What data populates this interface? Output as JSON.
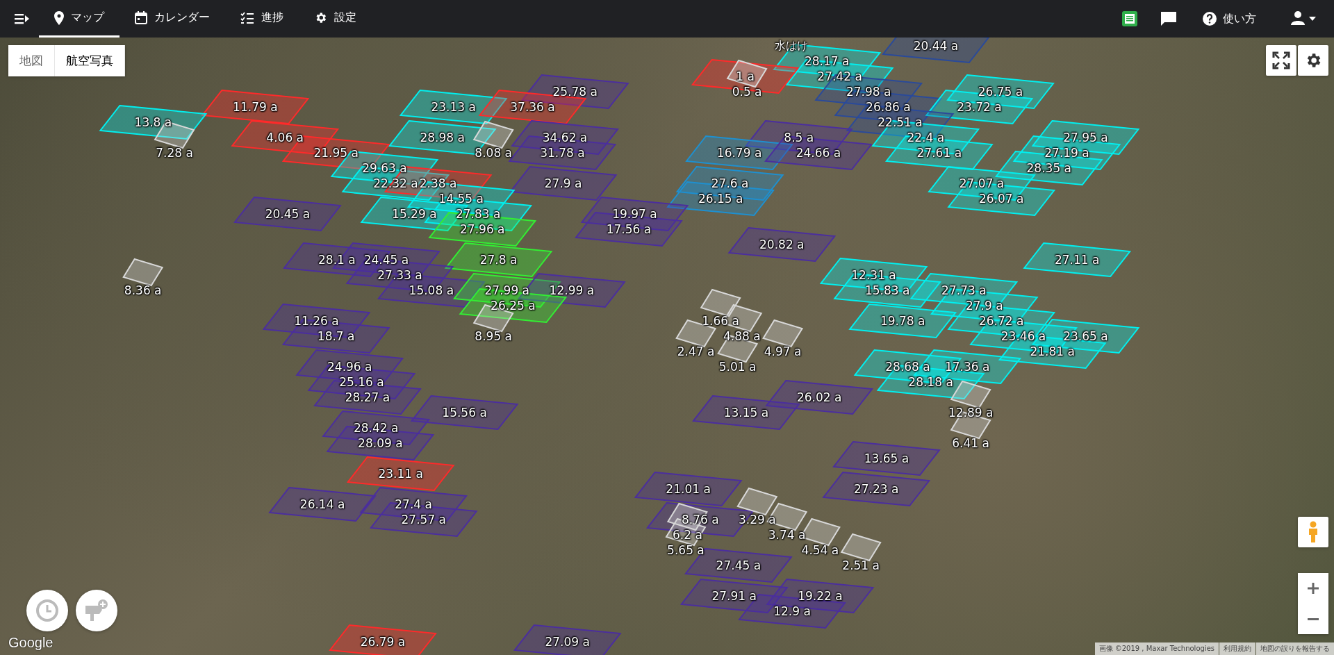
{
  "nav": {
    "tabs": [
      {
        "label": "マップ",
        "selected": true
      },
      {
        "label": "カレンダー",
        "selected": false
      },
      {
        "label": "進捗",
        "selected": false
      },
      {
        "label": "設定",
        "selected": false
      }
    ],
    "help_label": "使い方"
  },
  "map": {
    "type_tabs": [
      {
        "label": "地図",
        "selected": false
      },
      {
        "label": "航空写真",
        "selected": true
      }
    ],
    "notes": [
      "水はけ"
    ],
    "fields": [
      {
        "label": "20.44 a",
        "color": "#2a4a9a"
      },
      {
        "label": "28.17 a",
        "color": "#00f0f0"
      },
      {
        "label": "1 a",
        "color": "#ff2a2a"
      },
      {
        "label": "27.42 a",
        "color": "#00f0f0"
      },
      {
        "label": "25.78 a",
        "color": "#4b2e9e"
      },
      {
        "label": "0.5 a",
        "color": "#d8d8d8"
      },
      {
        "label": "27.98 a",
        "color": "#2a4a9a"
      },
      {
        "label": "26.75 a",
        "color": "#00f0f0"
      },
      {
        "label": "11.79 a",
        "color": "#ff2a2a"
      },
      {
        "label": "23.13 a",
        "color": "#00f0f0"
      },
      {
        "label": "37.36 a",
        "color": "#ff2a2a"
      },
      {
        "label": "26.86 a",
        "color": "#2a4a9a"
      },
      {
        "label": "23.72 a",
        "color": "#00f0f0"
      },
      {
        "label": "13.8 a",
        "color": "#00f0f0"
      },
      {
        "label": "22.51 a",
        "color": "#2a4a9a"
      },
      {
        "label": "4.06 a",
        "color": "#ff2a2a"
      },
      {
        "label": "28.98 a",
        "color": "#00f0f0"
      },
      {
        "label": "34.62 a",
        "color": "#4b2e9e"
      },
      {
        "label": "8.5 a",
        "color": "#4b2e9e"
      },
      {
        "label": "22.4 a",
        "color": "#00f0f0"
      },
      {
        "label": "27.95 a",
        "color": "#00f0f0"
      },
      {
        "label": "7.28 a",
        "color": "#d8d8d8"
      },
      {
        "label": "21.95 a",
        "color": "#ff2a2a"
      },
      {
        "label": "8.08 a",
        "color": "#d8d8d8"
      },
      {
        "label": "31.78 a",
        "color": "#4b2e9e"
      },
      {
        "label": "16.79 a",
        "color": "#1e90d0"
      },
      {
        "label": "24.66 a",
        "color": "#4b2e9e"
      },
      {
        "label": "27.61 a",
        "color": "#00f0f0"
      },
      {
        "label": "27.19 a",
        "color": "#00f0f0"
      },
      {
        "label": "29.63 a",
        "color": "#00f0f0"
      },
      {
        "label": "28.35 a",
        "color": "#00f0f0"
      },
      {
        "label": "22.32 a",
        "color": "#00f0f0"
      },
      {
        "label": "2.38 a",
        "color": "#ff2a2a"
      },
      {
        "label": "27.9 a",
        "color": "#4b2e9e"
      },
      {
        "label": "27.6 a",
        "color": "#1e90d0"
      },
      {
        "label": "27.07 a",
        "color": "#00f0f0"
      },
      {
        "label": "14.55 a",
        "color": "#00f0f0"
      },
      {
        "label": "26.15 a",
        "color": "#1e90d0"
      },
      {
        "label": "26.07 a",
        "color": "#00f0f0"
      },
      {
        "label": "20.45 a",
        "color": "#4b2e9e"
      },
      {
        "label": "15.29 a",
        "color": "#00f0f0"
      },
      {
        "label": "27.83 a",
        "color": "#00f0f0"
      },
      {
        "label": "19.97 a",
        "color": "#4b2e9e"
      },
      {
        "label": "27.96 a",
        "color": "#33ee33"
      },
      {
        "label": "17.56 a",
        "color": "#4b2e9e"
      },
      {
        "label": "20.82 a",
        "color": "#4b2e9e"
      },
      {
        "label": "28.1 a",
        "color": "#4b2e9e"
      },
      {
        "label": "24.45 a",
        "color": "#4b2e9e"
      },
      {
        "label": "27.8 a",
        "color": "#33ee33"
      },
      {
        "label": "27.11 a",
        "color": "#00f0f0"
      },
      {
        "label": "27.33 a",
        "color": "#4b2e9e"
      },
      {
        "label": "12.31 a",
        "color": "#00f0f0"
      },
      {
        "label": "8.36 a",
        "color": "#d8d8d8"
      },
      {
        "label": "15.08 a",
        "color": "#4b2e9e"
      },
      {
        "label": "27.99 a",
        "color": "#33ee33"
      },
      {
        "label": "12.99 a",
        "color": "#4b2e9e"
      },
      {
        "label": "15.83 a",
        "color": "#00f0f0"
      },
      {
        "label": "27.73 a",
        "color": "#00f0f0"
      },
      {
        "label": "26.25 a",
        "color": "#33ee33"
      },
      {
        "label": "27.9 a",
        "color": "#00f0f0"
      },
      {
        "label": "11.26 a",
        "color": "#4b2e9e"
      },
      {
        "label": "1.66 a",
        "color": "#d8d8d8"
      },
      {
        "label": "19.78 a",
        "color": "#00f0f0"
      },
      {
        "label": "26.72 a",
        "color": "#00f0f0"
      },
      {
        "label": "18.7 a",
        "color": "#4b2e9e"
      },
      {
        "label": "8.95 a",
        "color": "#d8d8d8"
      },
      {
        "label": "4.88 a",
        "color": "#d8d8d8"
      },
      {
        "label": "23.46 a",
        "color": "#00f0f0"
      },
      {
        "label": "23.65 a",
        "color": "#00f0f0"
      },
      {
        "label": "2.47 a",
        "color": "#d8d8d8"
      },
      {
        "label": "4.97 a",
        "color": "#d8d8d8"
      },
      {
        "label": "21.81 a",
        "color": "#00f0f0"
      },
      {
        "label": "24.96 a",
        "color": "#4b2e9e"
      },
      {
        "label": "5.01 a",
        "color": "#d8d8d8"
      },
      {
        "label": "28.68 a",
        "color": "#00f0f0"
      },
      {
        "label": "17.36 a",
        "color": "#00f0f0"
      },
      {
        "label": "25.16 a",
        "color": "#4b2e9e"
      },
      {
        "label": "28.18 a",
        "color": "#00f0f0"
      },
      {
        "label": "28.27 a",
        "color": "#4b2e9e"
      },
      {
        "label": "26.02 a",
        "color": "#4b2e9e"
      },
      {
        "label": "15.56 a",
        "color": "#4b2e9e"
      },
      {
        "label": "13.15 a",
        "color": "#4b2e9e"
      },
      {
        "label": "12.89 a",
        "color": "#d8d8d8"
      },
      {
        "label": "28.42 a",
        "color": "#4b2e9e"
      },
      {
        "label": "28.09 a",
        "color": "#4b2e9e"
      },
      {
        "label": "6.41 a",
        "color": "#d8d8d8"
      },
      {
        "label": "13.65 a",
        "color": "#4b2e9e"
      },
      {
        "label": "23.11 a",
        "color": "#ff2a2a"
      },
      {
        "label": "27.23 a",
        "color": "#4b2e9e"
      },
      {
        "label": "27.4 a",
        "color": "#4b2e9e"
      },
      {
        "label": "21.01 a",
        "color": "#4b2e9e"
      },
      {
        "label": "26.14 a",
        "color": "#4b2e9e"
      },
      {
        "label": "27.57 a",
        "color": "#4b2e9e"
      },
      {
        "label": "8.76 a",
        "color": "#4b2e9e"
      },
      {
        "label": "3.29 a",
        "color": "#d8d8d8"
      },
      {
        "label": "6.2 a",
        "color": "#d8d8d8"
      },
      {
        "label": "3.74 a",
        "color": "#d8d8d8"
      },
      {
        "label": "5.65 a",
        "color": "#d8d8d8"
      },
      {
        "label": "4.54 a",
        "color": "#d8d8d8"
      },
      {
        "label": "27.45 a",
        "color": "#4b2e9e"
      },
      {
        "label": "2.51 a",
        "color": "#d8d8d8"
      },
      {
        "label": "27.91 a",
        "color": "#4b2e9e"
      },
      {
        "label": "19.22 a",
        "color": "#4b2e9e"
      },
      {
        "label": "12.9 a",
        "color": "#4b2e9e"
      },
      {
        "label": "26.79 a",
        "color": "#ff2a2a"
      },
      {
        "label": "27.09 a",
        "color": "#4b2e9e"
      }
    ],
    "logo": "Google",
    "attribution": [
      "画像 ©2019 , Maxar Technologies",
      "利用規約",
      "地図の誤りを報告する"
    ]
  }
}
